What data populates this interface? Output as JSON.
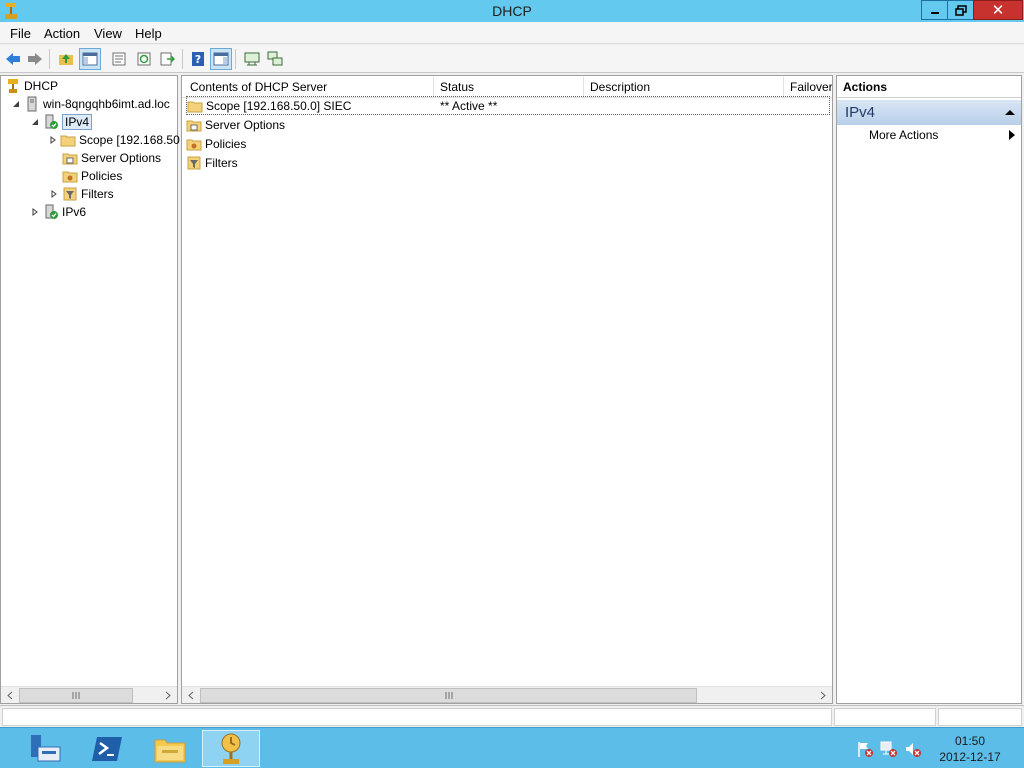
{
  "window": {
    "title": "DHCP",
    "close_glyph": "✕"
  },
  "menu": {
    "items": [
      "File",
      "Action",
      "View",
      "Help"
    ]
  },
  "toolbar": {
    "icons": [
      "back-arrow-icon",
      "forward-arrow-icon",
      "up-folder-icon",
      "show-hide-tree-icon",
      "properties-icon",
      "refresh-icon",
      "export-list-icon",
      "help-icon",
      "show-hide-action-pane-icon",
      "server-statistics-icon",
      "add-server-icon"
    ]
  },
  "tree": {
    "root": "DHCP",
    "server": "win-8qngqhb6imt.ad.loc",
    "ipv4": "IPv4",
    "scope": "Scope [192.168.50",
    "server_options": "Server Options",
    "policies": "Policies",
    "filters": "Filters",
    "ipv6": "IPv6"
  },
  "list": {
    "columns": [
      "Contents of DHCP Server",
      "Status",
      "Description",
      "Failover"
    ],
    "rows": [
      {
        "name": "Scope [192.168.50.0] SIEC",
        "status": "** Active **",
        "icon": "folder-icon"
      },
      {
        "name": "Server Options",
        "status": "",
        "icon": "server-options-icon"
      },
      {
        "name": "Policies",
        "status": "",
        "icon": "policies-icon"
      },
      {
        "name": "Filters",
        "status": "",
        "icon": "filters-icon"
      }
    ]
  },
  "actions": {
    "header": "Actions",
    "section": "IPv4",
    "more_actions": "More Actions"
  },
  "taskbar": {
    "time": "01:50",
    "date": "2012-12-17"
  },
  "colors": {
    "titlebar": "#63c9ef",
    "close_button": "#c7322f",
    "taskbar": "#5bbde8",
    "selection_border": "#7da2ce"
  }
}
